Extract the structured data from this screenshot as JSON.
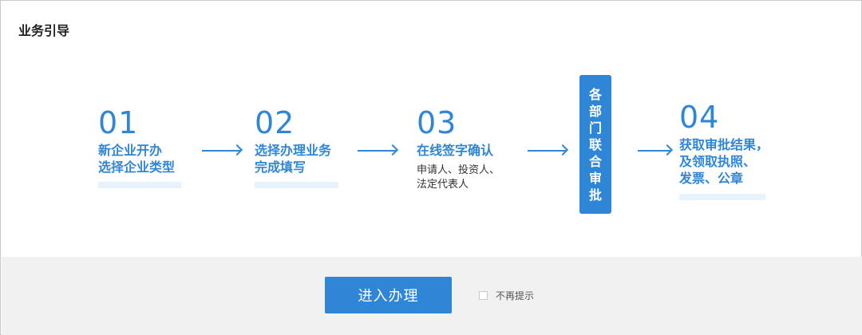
{
  "dialog": {
    "title": "业务引导"
  },
  "steps": [
    {
      "num": "01",
      "lines": [
        "新企业开办",
        "选择企业类型"
      ],
      "sub": []
    },
    {
      "num": "02",
      "lines": [
        "选择办理业务",
        "完成填写"
      ],
      "sub": []
    },
    {
      "num": "03",
      "lines": [
        "在线签字确认"
      ],
      "sub": [
        "申请人、投资人、",
        "法定代表人"
      ]
    },
    {
      "num": "04",
      "lines": [
        "获取审批结果，",
        "及领取执照、",
        "发票、公章"
      ],
      "sub": []
    }
  ],
  "department_box": {
    "chars": [
      "各",
      "部",
      "门",
      "联",
      "合",
      "审",
      "批"
    ]
  },
  "footer": {
    "enter_button_label": "进入办理",
    "no_remind_label": "不再提示",
    "no_remind_checked": false
  },
  "colors": {
    "accent": "#2f86d6",
    "underline": "#e7f2fd",
    "footer_bg": "#f1f1f1"
  }
}
